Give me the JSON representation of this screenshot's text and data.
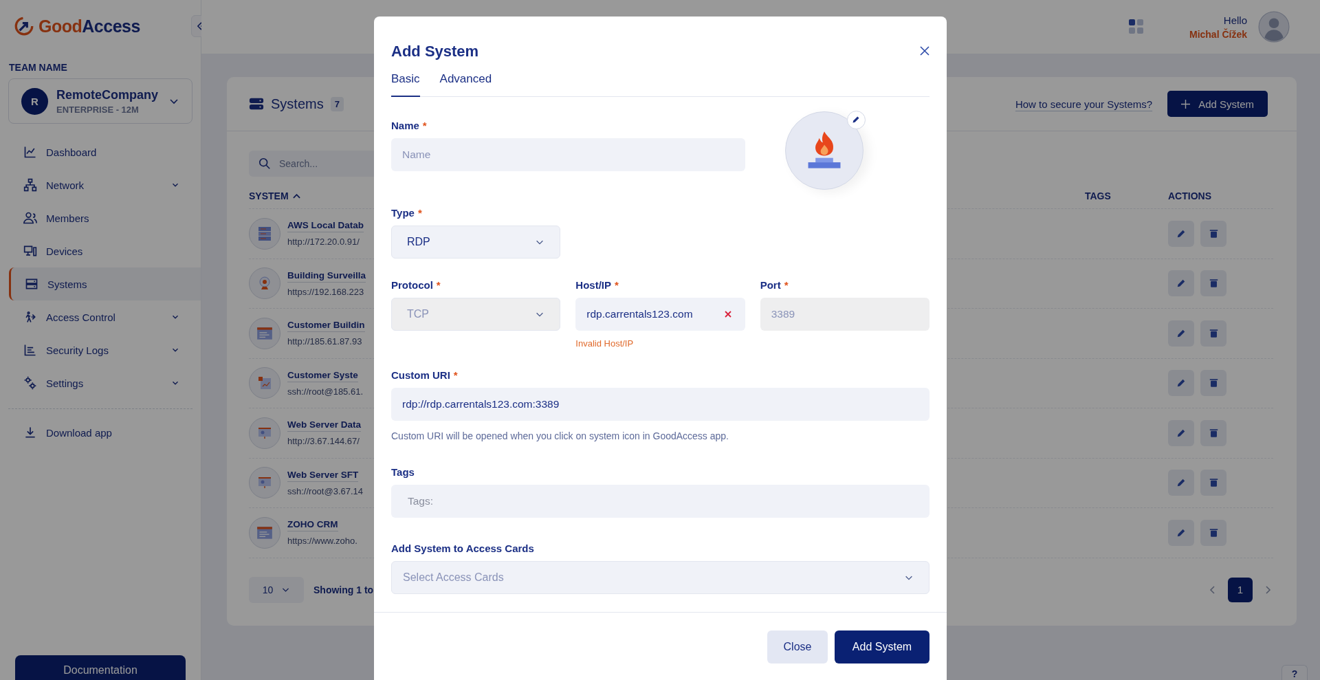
{
  "sidebar": {
    "logo": {
      "first": "Good",
      "second": "Access"
    },
    "team_label": "TEAM NAME",
    "team": {
      "initial": "R",
      "name": "RemoteCompany",
      "plan": "ENTERPRISE - 12M"
    },
    "nav": [
      {
        "label": "Dashboard",
        "kind": "chart",
        "expandable": false,
        "selected": false
      },
      {
        "label": "Network",
        "kind": "network",
        "expandable": true,
        "selected": false
      },
      {
        "label": "Members",
        "kind": "people",
        "expandable": false,
        "selected": false
      },
      {
        "label": "Devices",
        "kind": "devices",
        "expandable": false,
        "selected": false
      },
      {
        "label": "Systems",
        "kind": "server",
        "expandable": false,
        "selected": true
      },
      {
        "label": "Access Control",
        "kind": "access",
        "expandable": true,
        "selected": false
      },
      {
        "label": "Security Logs",
        "kind": "logs",
        "expandable": true,
        "selected": false
      },
      {
        "label": "Settings",
        "kind": "gears",
        "expandable": true,
        "selected": false
      }
    ],
    "download": "Download app",
    "documentation": "Documentation"
  },
  "header": {
    "greeting": "Hello",
    "user": "Michal Čížek"
  },
  "systems": {
    "title": "Systems",
    "count": "7",
    "help_link": "How to secure your Systems?",
    "add_button": "Add System",
    "search": {
      "placeholder": "Search..."
    },
    "columns": [
      {
        "label": "SYSTEM",
        "sort_ascending": true
      },
      {
        "label": "TAGS"
      },
      {
        "label": "ACTIONS"
      }
    ],
    "rows": [
      {
        "name": "AWS Local Datab",
        "url": "http://172.20.0.91/",
        "kind": "server"
      },
      {
        "name": "Building Surveilla",
        "url": "https://192.168.223",
        "kind": "webcam"
      },
      {
        "name": "Customer Buildin",
        "url": "http://185.61.87.93",
        "kind": "window"
      },
      {
        "name": "Customer Syste",
        "url": "ssh://root@185.61.",
        "kind": "chart"
      },
      {
        "name": "Web Server Data",
        "url": "http://3.67.144.67/",
        "kind": "screen"
      },
      {
        "name": "Web Server SFT",
        "url": "ssh://root@3.67.14",
        "kind": "screen"
      },
      {
        "name": "ZOHO CRM",
        "url": "https://www.zoho.",
        "kind": "window"
      }
    ],
    "page_size": "10",
    "showing": "Showing 1 to",
    "pages": [
      {
        "label": "1",
        "selected": true
      }
    ]
  },
  "modal": {
    "title": "Add System",
    "required_mark": "*",
    "tabs": [
      {
        "label": "Basic",
        "selected": true
      },
      {
        "label": "Advanced",
        "selected": false
      }
    ],
    "name": {
      "label": "Name",
      "required": true,
      "placeholder": "Name"
    },
    "type": {
      "label": "Type",
      "required": true,
      "value": "RDP",
      "disabled": false
    },
    "protocol": {
      "label": "Protocol",
      "required": true,
      "value": "TCP",
      "disabled": true
    },
    "host": {
      "label": "Host/IP",
      "required": true,
      "value": "rdp.carrentals123.com",
      "error": "Invalid Host/IP"
    },
    "port": {
      "label": "Port",
      "required": true,
      "value": "3389",
      "disabled": true
    },
    "custom_uri": {
      "label": "Custom URI",
      "required": true,
      "value": "rdp://rdp.carrentals123.com:3389",
      "help": "Custom URI will be opened when you click on system icon in GoodAccess app."
    },
    "tags": {
      "label": "Tags",
      "required": false,
      "placeholder": "Tags:"
    },
    "access_cards": {
      "label": "Add System to Access Cards",
      "required": false,
      "placeholder": "Select Access Cards"
    },
    "buttons": [
      {
        "label": "Close",
        "kind": "secondary"
      },
      {
        "label": "Add System",
        "kind": "primary"
      }
    ]
  },
  "help_button": "?"
}
